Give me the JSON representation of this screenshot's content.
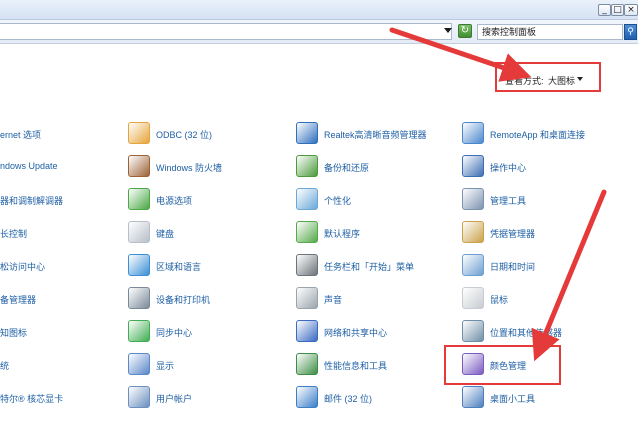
{
  "window": {
    "buttons": {
      "minimize": "_",
      "maximize": "□",
      "close": "×"
    }
  },
  "toolbar": {
    "refresh_icon": "refresh-icon",
    "search_placeholder": "搜索控制面板",
    "search_icon": "search-icon"
  },
  "view": {
    "label": "查看方式:",
    "value": "大图标"
  },
  "items": [
    [
      "ernet 选项",
      "ODBC (32 位)",
      "Realtek高清晰音频管理器",
      "RemoteApp 和桌面连接"
    ],
    [
      "ndows Update",
      "Windows 防火墙",
      "备份和还原",
      "操作中心"
    ],
    [
      "器和调制解调器",
      "电源选项",
      "个性化",
      "管理工具"
    ],
    [
      "长控制",
      "键盘",
      "默认程序",
      "凭据管理器"
    ],
    [
      "松访问中心",
      "区域和语言",
      "任务栏和「开始」菜单",
      "日期和时间"
    ],
    [
      "备管理器",
      "设备和打印机",
      "声音",
      "鼠标"
    ],
    [
      "知图标",
      "同步中心",
      "网络和共享中心",
      "位置和其他传感器"
    ],
    [
      "统",
      "显示",
      "性能信息和工具",
      "颜色管理"
    ],
    [
      "特尔® 核芯显卡",
      "用户帐户",
      "邮件 (32 位)",
      "桌面小工具"
    ]
  ],
  "icons": [
    [
      "internet-options-icon",
      "odbc-icon",
      "realtek-audio-icon",
      "remoteapp-icon"
    ],
    [
      "windows-update-icon",
      "firewall-icon",
      "backup-restore-icon",
      "action-center-icon"
    ],
    [
      "modem-icon",
      "power-options-icon",
      "personalize-icon",
      "admin-tools-icon"
    ],
    [
      "parental-control-icon",
      "keyboard-icon",
      "default-programs-icon",
      "credential-manager-icon"
    ],
    [
      "ease-of-access-icon",
      "region-language-icon",
      "taskbar-start-icon",
      "date-time-icon"
    ],
    [
      "device-manager-icon",
      "devices-printers-icon",
      "sound-icon",
      "mouse-icon"
    ],
    [
      "notification-icons-icon",
      "sync-center-icon",
      "network-sharing-icon",
      "location-sensors-icon"
    ],
    [
      "system-icon",
      "display-icon",
      "performance-icon",
      "color-management-icon"
    ],
    [
      "intel-graphics-icon",
      "user-accounts-icon",
      "mail-icon",
      "desktop-gadgets-icon"
    ]
  ],
  "colors": {
    "annotation_red": "#e53a3a",
    "link_blue": "#1e5fa5"
  }
}
